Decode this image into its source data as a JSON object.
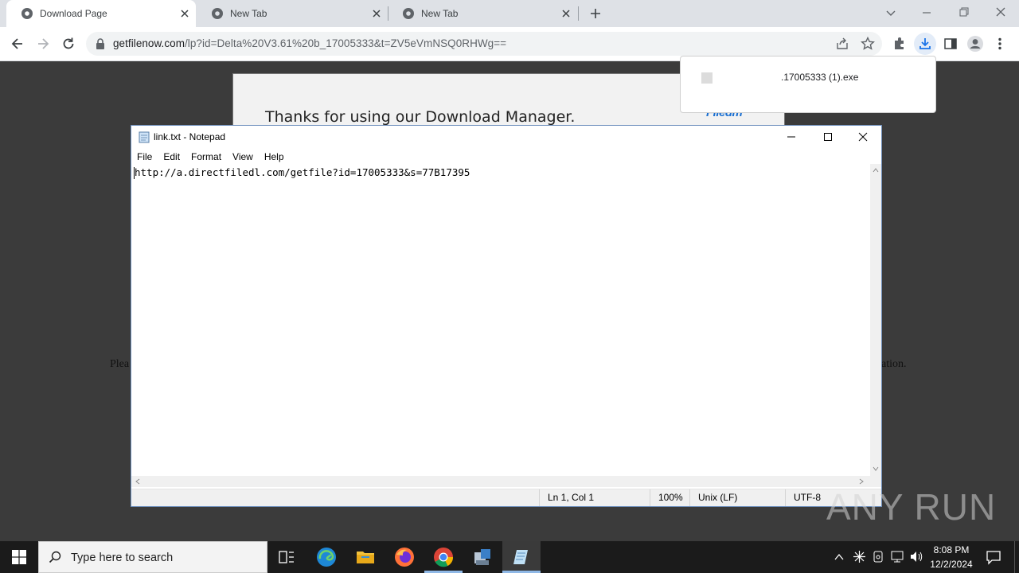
{
  "browser": {
    "tabs": [
      {
        "label": "Download Page",
        "active": true
      },
      {
        "label": "New Tab",
        "active": false
      },
      {
        "label": "New Tab",
        "active": false
      }
    ],
    "url_host": "getfilenow.com",
    "url_path": "/lp?id=Delta%20V3.61%20b_17005333&t=ZV5eVmNSQ0RHWg=="
  },
  "page": {
    "dm_title": "Thanks for using our Download Manager.",
    "dm_logo": "Filedm",
    "dm_min": "-",
    "dm_close": "x",
    "left_fragment": "Plea",
    "right_fragment": "ation."
  },
  "download_bubble": {
    "filename": ".17005333 (1).exe"
  },
  "notepad": {
    "title": "link.txt - Notepad",
    "menu": [
      "File",
      "Edit",
      "Format",
      "View",
      "Help"
    ],
    "content": "http://a.directfiledl.com/getfile?id=17005333&s=77B17395",
    "status": {
      "position": "Ln 1, Col 1",
      "zoom": "100%",
      "line_ending": "Unix (LF)",
      "encoding": "UTF-8"
    }
  },
  "watermark": "ANY RUN",
  "taskbar": {
    "search_placeholder": "Type here to search",
    "time": "8:08 PM",
    "date": "12/2/2024"
  }
}
